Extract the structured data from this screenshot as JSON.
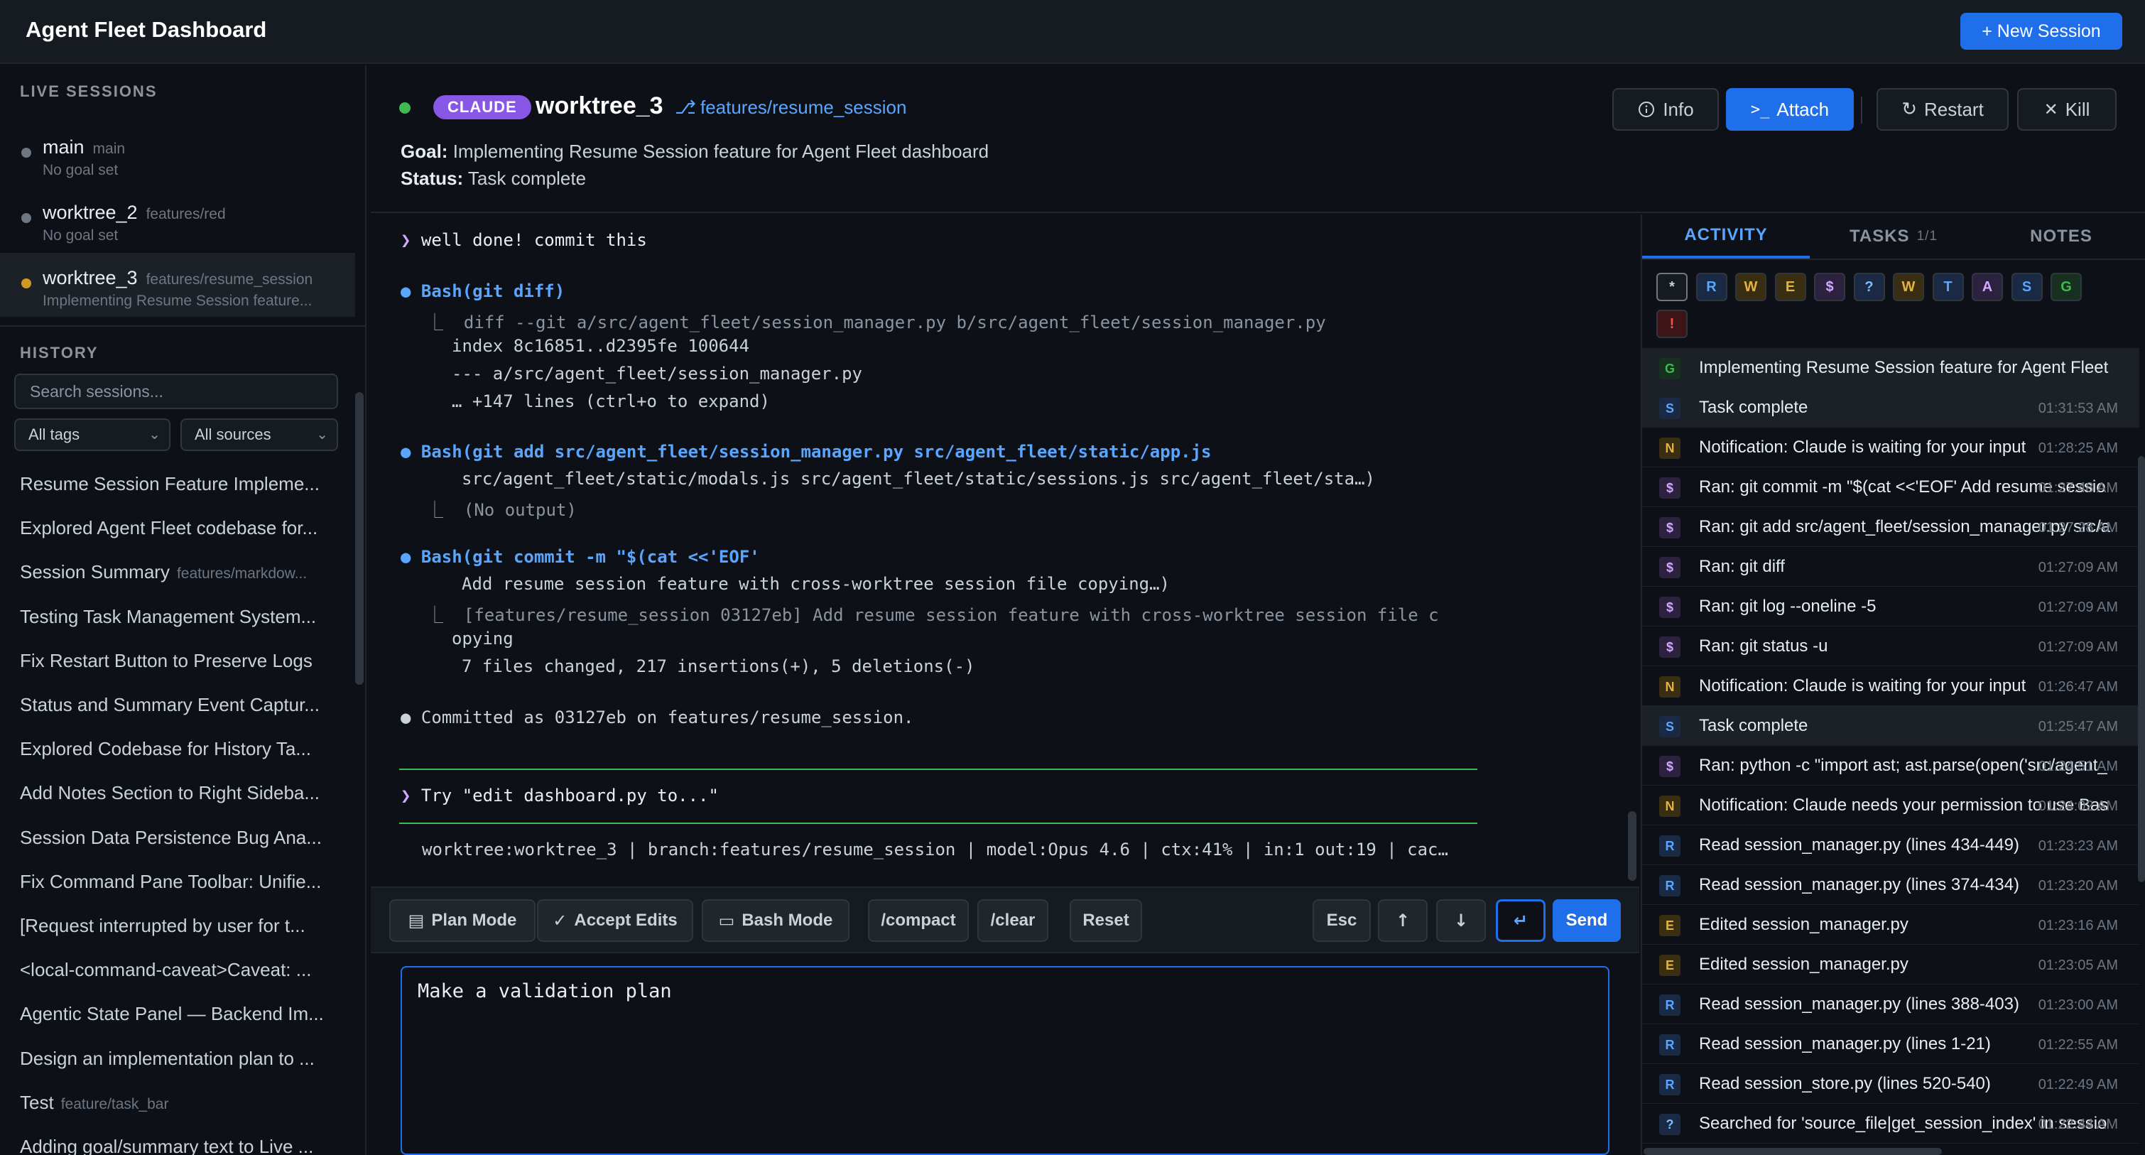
{
  "app": {
    "title": "Agent Fleet Dashboard",
    "new_session_label": "+ New Session"
  },
  "sidebar": {
    "live_title": "LIVE SESSIONS",
    "live": [
      {
        "name": "main",
        "branch": "main",
        "goal": "No goal set"
      },
      {
        "name": "worktree_2",
        "branch": "features/red",
        "goal": "No goal set"
      },
      {
        "name": "worktree_3",
        "branch": "features/resume_session",
        "goal": "Implementing Resume Session feature..."
      }
    ],
    "history_title": "HISTORY",
    "search_placeholder": "Search sessions...",
    "tags_filter": "All tags",
    "sources_filter": "All sources",
    "history": [
      {
        "title": "Resume Session Feature Impleme...",
        "tag": ""
      },
      {
        "title": "Explored Agent Fleet codebase for...",
        "tag": ""
      },
      {
        "title": "Session Summary",
        "tag": "features/markdow..."
      },
      {
        "title": "Testing Task Management System...",
        "tag": ""
      },
      {
        "title": "Fix Restart Button to Preserve Logs",
        "tag": ""
      },
      {
        "title": "Status and Summary Event Captur...",
        "tag": ""
      },
      {
        "title": "Explored Codebase for History Ta...",
        "tag": ""
      },
      {
        "title": "Add Notes Section to Right Sideba...",
        "tag": ""
      },
      {
        "title": "Session Data Persistence Bug Ana...",
        "tag": ""
      },
      {
        "title": "Fix Command Pane Toolbar: Unifie...",
        "tag": ""
      },
      {
        "title": "[Request interrupted by user for t...",
        "tag": ""
      },
      {
        "title": "<local-command-caveat>Caveat: ...",
        "tag": ""
      },
      {
        "title": "Agentic State Panel — Backend Im...",
        "tag": ""
      },
      {
        "title": "Design an implementation plan to ...",
        "tag": ""
      },
      {
        "title": "Test",
        "tag": "feature/task_bar"
      },
      {
        "title": "Adding goal/summary text to Live ...",
        "tag": ""
      }
    ]
  },
  "session": {
    "agent": "CLAUDE",
    "worktree": "worktree_3",
    "branch": "features/resume_session",
    "goal_label": "Goal:",
    "goal": "Implementing Resume Session feature for Agent Fleet dashboard",
    "status_label": "Status:",
    "status": "Task complete",
    "buttons": {
      "info": "Info",
      "attach": "Attach",
      "restart": "Restart",
      "kill": "Kill"
    }
  },
  "terminal": {
    "user_msg": "well done! commit this",
    "diff_tool": "Bash(git diff)",
    "diff_lines": [
      "diff --git a/src/agent_fleet/session_manager.py b/src/agent_fleet/session_manager.py",
      "index 8c16851..d2395fe 100644",
      "--- a/src/agent_fleet/session_manager.py",
      "… +147 lines (ctrl+o to expand)"
    ],
    "add_tool": "Bash(git add src/agent_fleet/session_manager.py src/agent_fleet/static/app.js",
    "add_cont": "src/agent_fleet/static/modals.js src/agent_fleet/static/sessions.js src/agent_fleet/sta…)",
    "add_out": "(No output)",
    "commit_tool": "Bash(git commit -m \"$(cat <<'EOF'",
    "commit_msg": "Add resume session feature with cross-worktree session file copying…)",
    "commit_out_1": "[features/resume_session 03127eb] Add resume session feature with cross-worktree session file c",
    "commit_out_2": "opying",
    "commit_out_3": "7 files changed, 217 insertions(+), 5 deletions(-)",
    "committed": "Committed as 03127eb on features/resume_session.",
    "suggestion": "Try \"edit dashboard.py to...\"",
    "statusline": "worktree:worktree_3 | branch:features/resume_session | model:Opus 4.6 | ctx:41% | in:1 out:19 | cac…"
  },
  "toolbar": {
    "plan_mode": "Plan Mode",
    "accept_edits": "Accept Edits",
    "bash_mode": "Bash Mode",
    "compact": "/compact",
    "clear": "/clear",
    "reset": "Reset",
    "esc": "Esc",
    "up": "↑",
    "down": "↓",
    "enter": "↵",
    "send": "Send"
  },
  "input": {
    "value": "Make a validation plan"
  },
  "right_panel": {
    "tabs": {
      "activity": "ACTIVITY",
      "tasks": "TASKS",
      "tasks_count": "1/1",
      "notes": "NOTES"
    },
    "filters": [
      "*",
      "R",
      "W",
      "E",
      "$",
      "?",
      "W",
      "T",
      "A",
      "S",
      "G",
      "!"
    ],
    "activity": [
      {
        "badge": "G",
        "text": "Implementing Resume Session feature for Agent Fleet",
        "time": ""
      },
      {
        "badge": "S",
        "text": "Task complete",
        "time": "01:31:53 AM"
      },
      {
        "badge": "N",
        "text": "Notification: Claude is waiting for your input",
        "time": "01:28:25 AM"
      },
      {
        "badge": "$",
        "text": "Ran: git commit -m \"$(cat <<'EOF' Add resume sessio",
        "time": "01:27:48 AM"
      },
      {
        "badge": "$",
        "text": "Ran: git add src/agent_fleet/session_manager.py src/a",
        "time": "01:27:28 AM"
      },
      {
        "badge": "$",
        "text": "Ran: git diff",
        "time": "01:27:09 AM"
      },
      {
        "badge": "$",
        "text": "Ran: git log --oneline -5",
        "time": "01:27:09 AM"
      },
      {
        "badge": "$",
        "text": "Ran: git status -u",
        "time": "01:27:09 AM"
      },
      {
        "badge": "N",
        "text": "Notification: Claude is waiting for your input",
        "time": "01:26:47 AM"
      },
      {
        "badge": "S",
        "text": "Task complete",
        "time": "01:25:47 AM"
      },
      {
        "badge": "$",
        "text": "Ran: python -c \"import ast; ast.parse(open('src/agent_",
        "time": "01:24:51 AM"
      },
      {
        "badge": "N",
        "text": "Notification: Claude needs your permission to use Bas",
        "time": "01:24:02 AM"
      },
      {
        "badge": "R",
        "text": "Read session_manager.py (lines 434-449)",
        "time": "01:23:23 AM"
      },
      {
        "badge": "R",
        "text": "Read session_manager.py (lines 374-434)",
        "time": "01:23:20 AM"
      },
      {
        "badge": "E",
        "text": "Edited session_manager.py",
        "time": "01:23:16 AM"
      },
      {
        "badge": "E",
        "text": "Edited session_manager.py",
        "time": "01:23:05 AM"
      },
      {
        "badge": "R",
        "text": "Read session_manager.py (lines 388-403)",
        "time": "01:23:00 AM"
      },
      {
        "badge": "R",
        "text": "Read session_manager.py (lines 1-21)",
        "time": "01:22:55 AM"
      },
      {
        "badge": "R",
        "text": "Read session_store.py (lines 520-540)",
        "time": "01:22:49 AM"
      },
      {
        "badge": "?",
        "text": "Searched for 'source_file|get_session_index' in sessio",
        "time": "01:22:44 AM"
      }
    ]
  },
  "colors": {
    "accent": "#1f6feb",
    "agent_badge": "#8957e5",
    "status_running": "#3fb950",
    "active_session": "#d29922"
  }
}
